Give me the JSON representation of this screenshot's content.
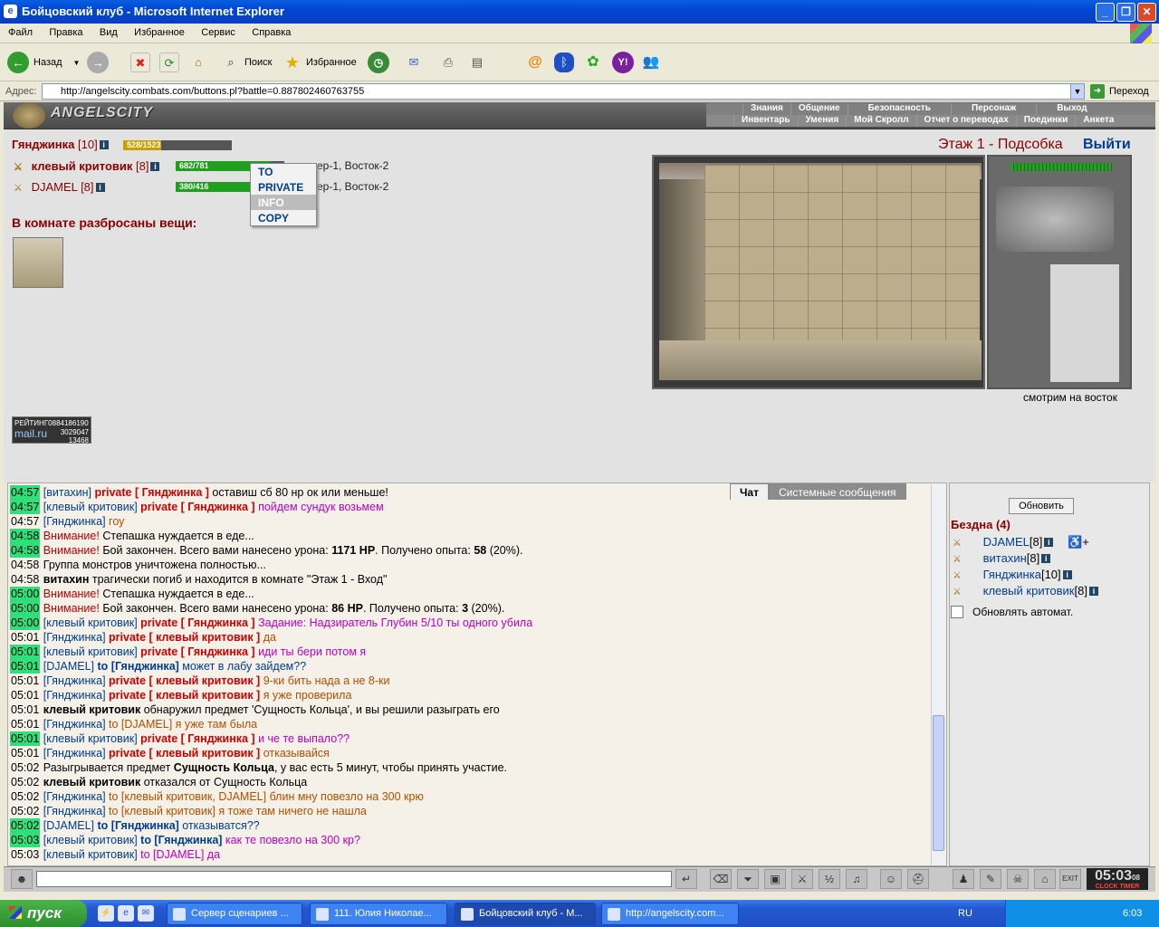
{
  "window": {
    "title": "Бойцовский клуб - Microsoft Internet Explorer",
    "min": "_",
    "max": "❐",
    "close": "✕"
  },
  "menu": [
    "Файл",
    "Правка",
    "Вид",
    "Избранное",
    "Сервис",
    "Справка"
  ],
  "toolbar": {
    "back": "Назад",
    "search": "Поиск",
    "favorites": "Избранное"
  },
  "address": {
    "label": "Адрес:",
    "url": "http://angelscity.combats.com/buttons.pl?battle=0.887802460763755",
    "go": "Переход"
  },
  "game": {
    "logo": "ANGELSCITY",
    "nav1": [
      "Знания",
      "Общение",
      "Безопасность",
      "Персонаж",
      "Выход"
    ],
    "nav2": [
      "Инвентарь",
      "Умения",
      "Мой Скролл",
      "Отчет о переводах",
      "Поединки",
      "Анкета"
    ],
    "self": {
      "name": "Гянджинка",
      "level": "[10]",
      "hp": "528/1523",
      "hp_fraction": 0.35
    },
    "others": [
      {
        "name": "клевый критовик",
        "level": "[8]",
        "hp": "682/781",
        "hp_fraction": 0.87,
        "pos": "ер-1, Восток-2"
      },
      {
        "name": "DJAMEL",
        "level": "[8]",
        "hp": "380/416",
        "hp_fraction": 0.91,
        "pos": "ер-1, Восток-2"
      }
    ],
    "context_menu": [
      "TO",
      "PRIVATE",
      "INFO",
      "COPY"
    ],
    "items_header": "В комнате разбросаны вещи:",
    "room": "Этаж 1 - Подсобка",
    "exit": "Выйти",
    "look": "смотрим на восток",
    "counter": {
      "label": "РЕЙТИНГ",
      "brand": "mail.ru",
      "v1": "0884186190",
      "v2": "3029047",
      "v3": "13468"
    }
  },
  "chat": {
    "tabs": [
      "Чат",
      "Системные сообщения"
    ],
    "lines": [
      {
        "t": "04:57",
        "hl": true,
        "parts": [
          [
            "nm",
            "[витахин] "
          ],
          [
            "pv",
            "private [ Гянджинка ] "
          ],
          [
            "bk",
            "оставиш сб 80 нр ок или меньше!"
          ]
        ]
      },
      {
        "t": "04:57",
        "hl": true,
        "parts": [
          [
            "nm",
            "[клевый критовик] "
          ],
          [
            "pv",
            "private [ Гянджинка ] "
          ],
          [
            "msg-r",
            "пойдем сундук возьмем"
          ]
        ]
      },
      {
        "t": "04:57",
        "hl": false,
        "parts": [
          [
            "nm",
            "[Гянджинка] "
          ],
          [
            "msg-o",
            "гоу"
          ]
        ]
      },
      {
        "t": "04:58",
        "hl": true,
        "parts": [
          [
            "warn",
            "Внимание! "
          ],
          [
            "bk",
            "Степашка нуждается в еде..."
          ]
        ]
      },
      {
        "t": "04:58",
        "hl": true,
        "parts": [
          [
            "warn",
            "Внимание! "
          ],
          [
            "bk",
            "Бой закончен. Всего вами нанесено урона: "
          ],
          [
            "b",
            "1171 HP"
          ],
          [
            "bk",
            ". Получено опыта: "
          ],
          [
            "b",
            "58"
          ],
          [
            "bk",
            " (20%)."
          ]
        ]
      },
      {
        "t": "04:58",
        "hl": false,
        "parts": [
          [
            "bk",
            "Группа монстров уничтожена полностью..."
          ]
        ]
      },
      {
        "t": "04:58",
        "hl": false,
        "parts": [
          [
            "b",
            "витахин"
          ],
          [
            "bk",
            " трагически погиб и находится в комнате \"Этаж 1 - Вход\""
          ]
        ]
      },
      {
        "t": "05:00",
        "hl": true,
        "parts": [
          [
            "warn",
            "Внимание! "
          ],
          [
            "bk",
            "Степашка нуждается в еде..."
          ]
        ]
      },
      {
        "t": "05:00",
        "hl": true,
        "parts": [
          [
            "warn",
            "Внимание! "
          ],
          [
            "bk",
            "Бой закончен. Всего вами нанесено урона: "
          ],
          [
            "b",
            "86 HP"
          ],
          [
            "bk",
            ". Получено опыта: "
          ],
          [
            "b",
            "3"
          ],
          [
            "bk",
            " (20%)."
          ]
        ]
      },
      {
        "t": "05:00",
        "hl": true,
        "parts": [
          [
            "nm",
            "[клевый критовик] "
          ],
          [
            "pv",
            "private [ Гянджинка ] "
          ],
          [
            "msg-r",
            "Задание: Надзиратель Глубин 5/10 ты одного убила"
          ]
        ]
      },
      {
        "t": "05:01",
        "hl": false,
        "parts": [
          [
            "nm",
            "[Гянджинка] "
          ],
          [
            "pv",
            "private [ клевый критовик ] "
          ],
          [
            "msg-o",
            "да"
          ]
        ]
      },
      {
        "t": "05:01",
        "hl": true,
        "parts": [
          [
            "nm",
            "[клевый критовик] "
          ],
          [
            "pv",
            "private [ Гянджинка ] "
          ],
          [
            "msg-r",
            "иди ты бери потом я"
          ]
        ]
      },
      {
        "t": "05:01",
        "hl": true,
        "parts": [
          [
            "nm",
            "[DJAMEL] "
          ],
          [
            "to",
            "to [Гянджинка] "
          ],
          [
            "msg-b",
            "может в лабу зайдем??"
          ]
        ]
      },
      {
        "t": "05:01",
        "hl": false,
        "parts": [
          [
            "nm",
            "[Гянджинка] "
          ],
          [
            "pv",
            "private [ клевый критовик ] "
          ],
          [
            "msg-o",
            "9-ки бить нада а не 8-ки"
          ]
        ]
      },
      {
        "t": "05:01",
        "hl": false,
        "parts": [
          [
            "nm",
            "[Гянджинка] "
          ],
          [
            "pv",
            "private [ клевый критовик ] "
          ],
          [
            "msg-o",
            "я уже проверила"
          ]
        ]
      },
      {
        "t": "05:01",
        "hl": false,
        "parts": [
          [
            "b",
            "клевый критовик"
          ],
          [
            "bk",
            " обнаружил предмет 'Сущность Кольца', и вы решили разыграть его"
          ]
        ]
      },
      {
        "t": "05:01",
        "hl": false,
        "parts": [
          [
            "nm",
            "[Гянджинка] "
          ],
          [
            "msg-o",
            "to [DJAMEL] я уже там была"
          ]
        ]
      },
      {
        "t": "05:01",
        "hl": true,
        "parts": [
          [
            "nm",
            "[клевый критовик] "
          ],
          [
            "pv",
            "private [ Гянджинка ] "
          ],
          [
            "msg-r",
            "и че те выпало??"
          ]
        ]
      },
      {
        "t": "05:01",
        "hl": false,
        "parts": [
          [
            "nm",
            "[Гянджинка] "
          ],
          [
            "pv",
            "private [ клевый критовик ] "
          ],
          [
            "msg-o",
            "отказывайся"
          ]
        ]
      },
      {
        "t": "05:02",
        "hl": false,
        "parts": [
          [
            "bk",
            "Разыгрывается предмет "
          ],
          [
            "b",
            "Сущность Кольца"
          ],
          [
            "bk",
            ", у вас есть 5 минут, чтобы принять участие."
          ]
        ]
      },
      {
        "t": "05:02",
        "hl": false,
        "parts": [
          [
            "b",
            "клевый критовик"
          ],
          [
            "bk",
            " отказался от Сущность Кольца"
          ]
        ]
      },
      {
        "t": "05:02",
        "hl": false,
        "parts": [
          [
            "nm",
            "[Гянджинка] "
          ],
          [
            "msg-o",
            "to [клевый критовик, DJAMEL] блин мну повезло на 300 крю"
          ]
        ]
      },
      {
        "t": "05:02",
        "hl": false,
        "parts": [
          [
            "nm",
            "[Гянджинка] "
          ],
          [
            "msg-o",
            "to [клевый критовик] я тоже там ничего не нашла"
          ]
        ]
      },
      {
        "t": "05:02",
        "hl": true,
        "parts": [
          [
            "nm",
            "[DJAMEL] "
          ],
          [
            "to",
            "to [Гянджинка] "
          ],
          [
            "msg-b",
            "отказыватся??"
          ]
        ]
      },
      {
        "t": "05:03",
        "hl": true,
        "parts": [
          [
            "nm",
            "[клевый критовик] "
          ],
          [
            "to",
            "to [Гянджинка] "
          ],
          [
            "msg-r",
            "как те повезло на 300 кр?"
          ]
        ]
      },
      {
        "t": "05:03",
        "hl": false,
        "parts": [
          [
            "nm",
            "[клевый критовик] "
          ],
          [
            "msg-r",
            "to [DJAMEL] да"
          ]
        ]
      }
    ]
  },
  "right": {
    "refresh": "Обновить",
    "room": "Бездна (4)",
    "players": [
      {
        "name": "DJAMEL",
        "lvl": "[8]"
      },
      {
        "name": "витахин",
        "lvl": "[8]"
      },
      {
        "name": "Гянджинка",
        "lvl": "[10]"
      },
      {
        "name": "клевый критовик",
        "lvl": "[8]"
      }
    ],
    "auto": "Обновлять автомат."
  },
  "clock": {
    "time": "05:03",
    "sec": "08",
    "label": "CLOCK TIMER"
  },
  "taskbar": {
    "start": "пуск",
    "tasks": [
      "Сервер сценариев ...",
      "111. Юлия Николае...",
      "Бойцовский клуб - M...",
      "http://angelscity.com..."
    ],
    "lang": "RU",
    "time": "6:03"
  }
}
